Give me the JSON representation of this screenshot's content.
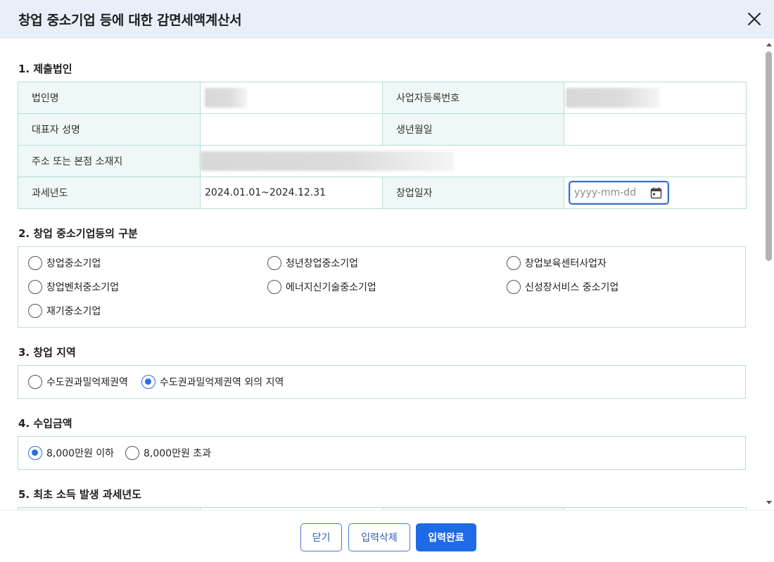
{
  "dialog": {
    "title": "창업 중소기업 등에 대한 감면세액계산서"
  },
  "section1": {
    "title": "1. 제출법인",
    "corp_name_label": "법인명",
    "biz_reg_label": "사업자등록번호",
    "rep_name_label": "대표자 성명",
    "birth_label": "생년월일",
    "address_label": "주소 또는 본점 소재지",
    "tax_year_label": "과세년도",
    "tax_year_value": "2024.01.01~2024.12.31",
    "startup_date_label": "창업일자",
    "startup_date_placeholder": "yyyy-mm-dd"
  },
  "section2": {
    "title": "2. 창업 중소기업등의 구분",
    "options": [
      "창업중소기업",
      "청년창업중소기업",
      "창업보육센터사업자",
      "창업벤처중소기업",
      "에너지신기술중소기업",
      "신성장서비스 중소기업",
      "재기중소기업"
    ]
  },
  "section3": {
    "title": "3. 창업 지역",
    "options": [
      "수도권과밀억제권역",
      "수도권과밀억제권역 외의 지역"
    ],
    "selected": "수도권과밀억제권역 외의 지역"
  },
  "section4": {
    "title": "4. 수입금액",
    "options": [
      "8,000만원 이하",
      "8,000만원 초과"
    ],
    "selected": "8,000만원 이하"
  },
  "section5": {
    "title": "5. 최초 소득 발생 과세년도"
  },
  "footer": {
    "close_label": "닫기",
    "delete_label": "입력삭제",
    "complete_label": "입력완료"
  },
  "colors": {
    "accent": "#1f6ae8",
    "header_bg": "#e9eff8",
    "table_label_bg": "#eef8f6",
    "table_border": "#b9dcd9"
  }
}
